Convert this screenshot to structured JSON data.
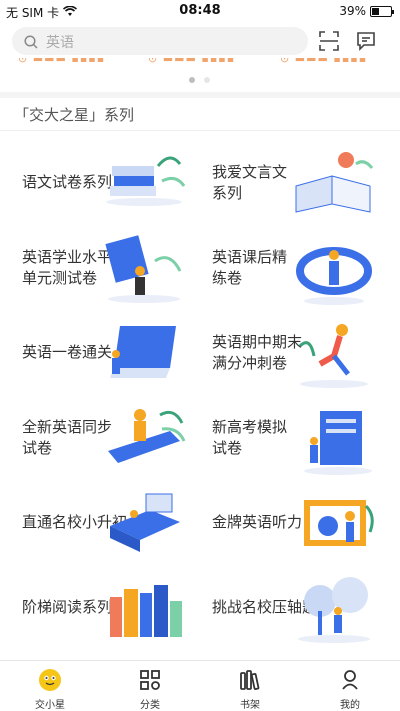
{
  "status_bar": {
    "carrier": "无 SIM 卡",
    "time": "08:48",
    "battery": "39%",
    "battery_level": 0.39
  },
  "search": {
    "placeholder": "英语"
  },
  "icons": {
    "search": "search-icon",
    "scan": "scan-icon",
    "message": "message-icon"
  },
  "carousel": {
    "pages": 2,
    "active": 0
  },
  "section": {
    "title": "「交大之星」系列"
  },
  "books": [
    {
      "line1": "语文试卷系列",
      "line2": "",
      "art": "book-stack-illustration"
    },
    {
      "line1": "我爱文言文",
      "line2": "系列",
      "art": "open-book-illustration"
    },
    {
      "line1": "英语学业水平",
      "line2": "单元测试卷",
      "art": "reading-person-illustration"
    },
    {
      "line1": "英语课后精",
      "line2": "练卷",
      "art": "scroll-person-illustration"
    },
    {
      "line1": "英语一卷通关",
      "line2": "",
      "art": "paper-roll-illustration"
    },
    {
      "line1": "英语期中期末",
      "line2": "满分冲刺卷",
      "art": "runner-illustration"
    },
    {
      "line1": "全新英语同步",
      "line2": "试卷",
      "art": "sitting-person-illustration"
    },
    {
      "line1": "新高考模拟",
      "line2": "试卷",
      "art": "document-illustration"
    },
    {
      "line1": "直通名校小升初",
      "line2": "",
      "art": "desk-illustration"
    },
    {
      "line1": "金牌英语听力",
      "line2": "",
      "art": "headphone-illustration"
    },
    {
      "line1": "阶梯阅读系列",
      "line2": "",
      "art": "bookshelf-illustration"
    },
    {
      "line1": "挑战名校压轴题",
      "line2": "",
      "art": "tree-person-illustration"
    }
  ],
  "colors": {
    "accent_blue": "#3a6fe8",
    "accent_orange": "#f5a623",
    "tab_active": "#f5c518"
  },
  "tabs": [
    {
      "label": "交小星",
      "icon": "mascot-icon",
      "active": true
    },
    {
      "label": "分类",
      "icon": "category-icon",
      "active": false
    },
    {
      "label": "书架",
      "icon": "bookshelf-icon",
      "active": false
    },
    {
      "label": "我的",
      "icon": "profile-icon",
      "active": false
    }
  ]
}
